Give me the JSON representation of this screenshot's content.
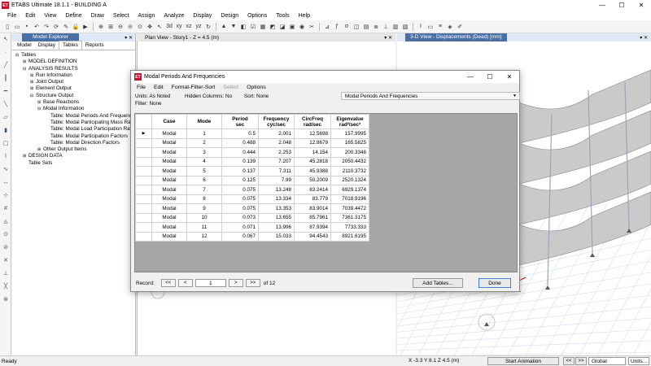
{
  "app": {
    "title": "ETABS Ultimate 18.1.1 - BUILDING A",
    "logo": "ET",
    "window_controls": {
      "min": "—",
      "max": "☐",
      "close": "✕"
    }
  },
  "menu": [
    "File",
    "Edit",
    "View",
    "Define",
    "Draw",
    "Select",
    "Assign",
    "Analyze",
    "Display",
    "Design",
    "Options",
    "Tools",
    "Help"
  ],
  "model_explorer": {
    "title": "Model Explorer",
    "controls": "▾ ✕",
    "tabs": [
      "Model",
      "Display",
      "Tables",
      "Reports"
    ],
    "active_tab": "Tables",
    "tree": [
      {
        "level": 0,
        "exp": "⊟",
        "label": "Tables"
      },
      {
        "level": 1,
        "exp": "⊞",
        "label": "MODEL DEFINITION"
      },
      {
        "level": 1,
        "exp": "⊟",
        "label": "ANALYSIS RESULTS"
      },
      {
        "level": 2,
        "exp": "⊞",
        "label": "Run Information"
      },
      {
        "level": 2,
        "exp": "⊞",
        "label": "Joint Output"
      },
      {
        "level": 2,
        "exp": "⊞",
        "label": "Element Output"
      },
      {
        "level": 2,
        "exp": "⊟",
        "label": "Structure Output"
      },
      {
        "level": 3,
        "exp": "⊞",
        "label": "Base Reactions"
      },
      {
        "level": 3,
        "exp": "⊟",
        "label": "Modal Information"
      },
      {
        "level": 4,
        "exp": "",
        "label": "Table:  Modal Periods And Frequencies"
      },
      {
        "level": 4,
        "exp": "",
        "label": "Table:  Modal Participating Mass Ratios"
      },
      {
        "level": 4,
        "exp": "",
        "label": "Table:  Modal Load Participation Ratios"
      },
      {
        "level": 4,
        "exp": "",
        "label": "Table:  Modal Participation Factors"
      },
      {
        "level": 4,
        "exp": "",
        "label": "Table:  Modal Direction Factors"
      },
      {
        "level": 3,
        "exp": "⊞",
        "label": "Other Output Items"
      },
      {
        "level": 1,
        "exp": "⊞",
        "label": "DESIGN DATA"
      },
      {
        "level": 1,
        "exp": "",
        "label": "Table Sets"
      }
    ]
  },
  "plan_view": {
    "title": "Plan View - Story1 - Z = 4.5 (m)",
    "controls": "▾ ✕"
  },
  "view_3d": {
    "title": "3-D View  -  Displacements (Dead)  [mm]",
    "controls": "▾ ✕"
  },
  "dialog": {
    "logo": "ET",
    "title": "Modal Periods And Frequencies",
    "controls": {
      "min": "—",
      "max": "☐",
      "close": "✕"
    },
    "menu": [
      "File",
      "Edit",
      "Format-Filter-Sort",
      "Select",
      "Options"
    ],
    "units": "Units:  As Noted",
    "hidden_columns": "Hidden Columns:  No",
    "sort": "Sort:  None",
    "table_select": "Modal Periods And Frequencies",
    "filter": "Filter:  None",
    "columns": [
      {
        "line1": "Case",
        "line2": ""
      },
      {
        "line1": "Mode",
        "line2": ""
      },
      {
        "line1": "Period",
        "line2": "sec"
      },
      {
        "line1": "Frequency",
        "line2": "cyc/sec"
      },
      {
        "line1": "CircFreq",
        "line2": "rad/sec"
      },
      {
        "line1": "Eigenvalue",
        "line2": "rad²/sec²"
      }
    ],
    "rows": [
      [
        "Modal",
        "1",
        "0.5",
        "2.001",
        "12.5698",
        "157.9995"
      ],
      [
        "Modal",
        "2",
        "0.488",
        "2.048",
        "12.8679",
        "165.5825"
      ],
      [
        "Modal",
        "3",
        "0.444",
        "2.253",
        "14.154",
        "200.3348"
      ],
      [
        "Modal",
        "4",
        "0.139",
        "7.207",
        "45.2818",
        "2050.4432"
      ],
      [
        "Modal",
        "5",
        "0.137",
        "7.311",
        "45.9388",
        "2110.3732"
      ],
      [
        "Modal",
        "6",
        "0.125",
        "7.99",
        "50.2009",
        "2520.1324"
      ],
      [
        "Modal",
        "7",
        "0.075",
        "13.248",
        "83.2414",
        "6929.1374"
      ],
      [
        "Modal",
        "8",
        "0.075",
        "13.334",
        "83.779",
        "7018.9196"
      ],
      [
        "Modal",
        "9",
        "0.075",
        "13.353",
        "83.9014",
        "7039.4472"
      ],
      [
        "Modal",
        "10",
        "0.073",
        "13.655",
        "85.7961",
        "7361.3175"
      ],
      [
        "Modal",
        "11",
        "0.071",
        "13.996",
        "87.9394",
        "7733.333"
      ],
      [
        "Modal",
        "12",
        "0.067",
        "15.033",
        "94.4543",
        "8921.6195"
      ]
    ],
    "record_label": "Record:",
    "record_value": "1",
    "record_of": "of 12",
    "nav": {
      "first": "<<",
      "prev": "<",
      "next": ">",
      "last": ">>"
    },
    "add_tables": "Add Tables...",
    "done": "Done"
  },
  "status": {
    "text": "Ready",
    "coords": "X -3.3  Y 8.1  Z 4.5 (m)",
    "start_animation": "Start Animation",
    "global": "Global",
    "units": "Units..."
  }
}
